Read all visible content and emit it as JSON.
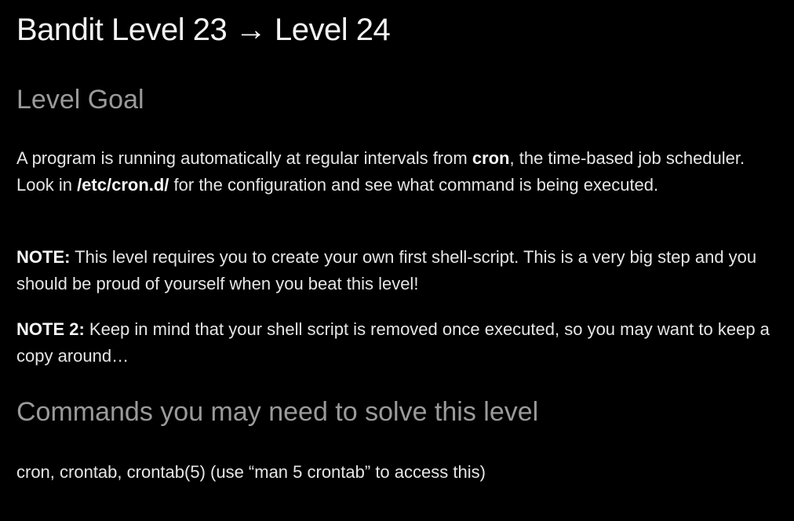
{
  "title": "Bandit Level 23 → Level 24",
  "goal": {
    "heading": "Level Goal",
    "p1_a": "A program is running automatically at regular intervals from ",
    "p1_cron": "cron",
    "p1_b": ", the time-based job scheduler. Look in ",
    "p1_path": "/etc/cron.d/",
    "p1_c": " for the configuration and see what command is being executed.",
    "note1_label": "NOTE:",
    "note1_text": " This level requires you to create your own first shell-script. This is a very big step and you should be proud of yourself when you beat this level!",
    "note2_label": "NOTE 2:",
    "note2_text": " Keep in mind that your shell script is removed once executed, so you may want to keep a copy around…"
  },
  "commands": {
    "heading": "Commands you may need to solve this level",
    "text": "cron, crontab, crontab(5) (use “man 5 crontab” to access this)"
  }
}
